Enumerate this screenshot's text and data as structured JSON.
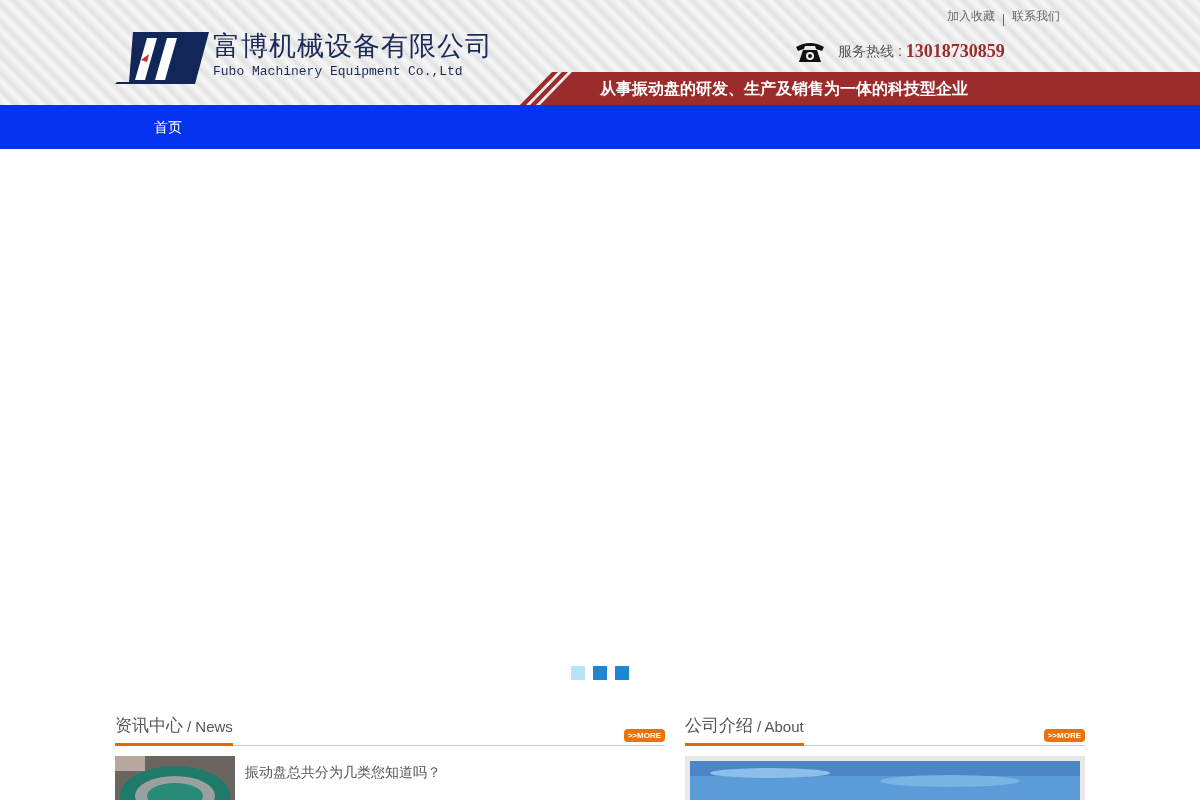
{
  "header": {
    "company_name": "富博机械设备有限公司",
    "company_name_en": "Fubo Machinery Equipment Co.,Ltd",
    "top_links": [
      "加入收藏",
      "联系我们"
    ],
    "hotline_label": "服务热线 :",
    "hotline_number": "13018730859",
    "slogan": "从事振动盘的研发、生产及销售为一体的科技型企业"
  },
  "nav": {
    "items": [
      {
        "label": "首页",
        "selected": true
      }
    ]
  },
  "slider": {
    "dots": [
      {
        "selected": true
      },
      {
        "selected": false
      },
      {
        "selected": false
      }
    ]
  },
  "news": {
    "title": "资讯中心",
    "title_en": "/ News",
    "more": ">>MORE",
    "items": [
      {
        "title": "振动盘总共分为几类您知道吗？"
      }
    ]
  },
  "about": {
    "title": "公司介绍",
    "title_en": "/ About",
    "more": ">>MORE"
  }
}
